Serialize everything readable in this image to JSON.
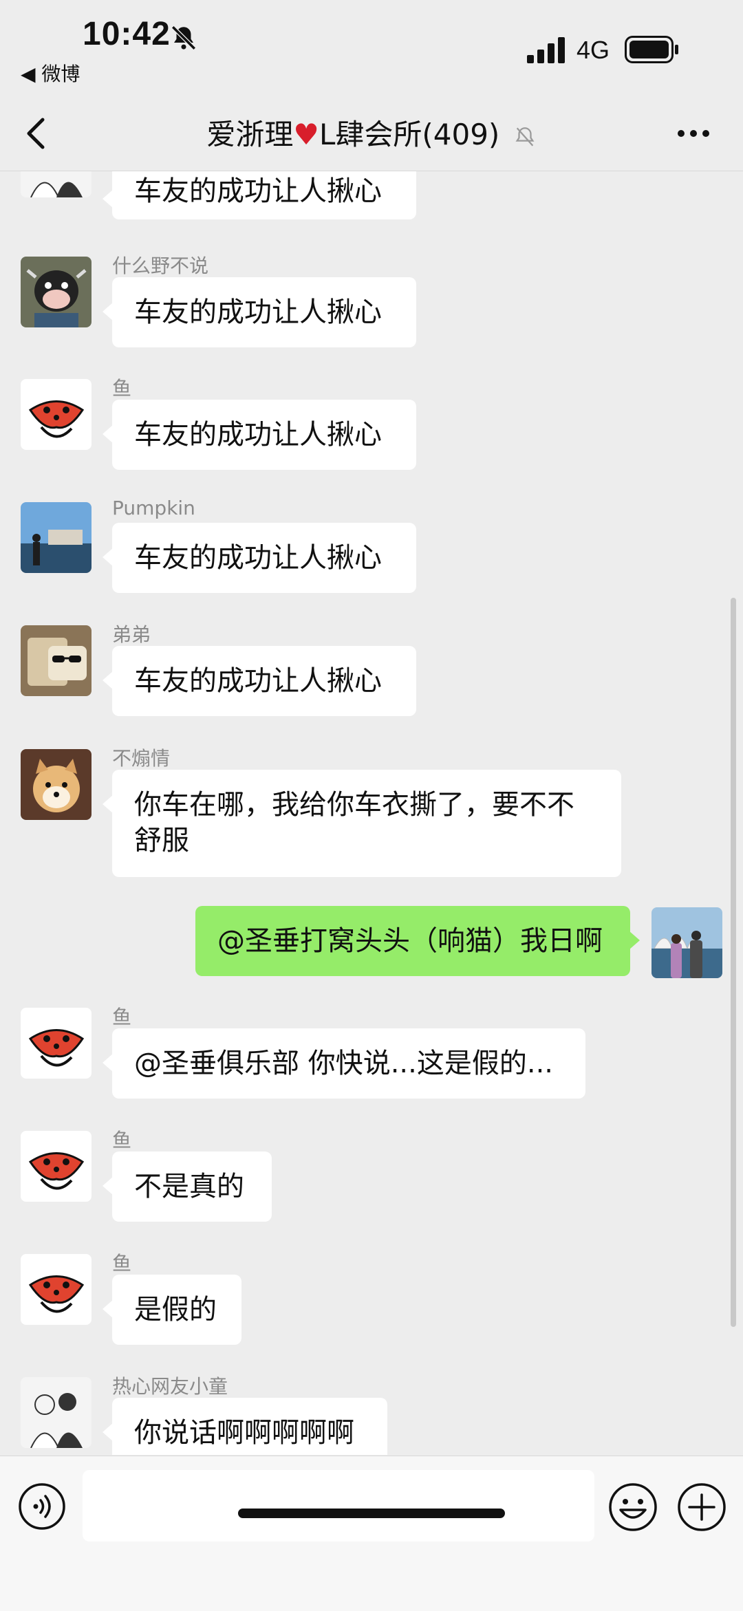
{
  "status_bar": {
    "time": "10:42",
    "back_app": "◀ 微博",
    "network": "4G"
  },
  "nav": {
    "title_prefix": "爱浙理",
    "title_suffix": "L肆会所(409)"
  },
  "messages": [
    {
      "sender": "",
      "text": "车友的成功让人揪心",
      "avatar_icon": "couple-sketch-avatar"
    },
    {
      "sender": "什么野不说",
      "text": "车友的成功让人揪心",
      "avatar_icon": "cow-avatar"
    },
    {
      "sender": "鱼",
      "text": "车友的成功让人揪心",
      "avatar_icon": "red-mask-avatar"
    },
    {
      "sender": "Pumpkin",
      "text": "车友的成功让人揪心",
      "avatar_icon": "harbor-photo-avatar"
    },
    {
      "sender": "弟弟",
      "text": "车友的成功让人揪心",
      "avatar_icon": "sunglasses-cat-avatar"
    },
    {
      "sender": "不煽情",
      "text": "你车在哪，我给你车衣撕了，要不不舒服",
      "avatar_icon": "shiba-avatar"
    },
    {
      "sender": "",
      "text": "@圣垂打窝头头（响猫）我日啊",
      "avatar_icon": "opera-house-avatar",
      "mine": true
    },
    {
      "sender": "鱼",
      "text": "@圣垂俱乐部 你快说...这是假的...",
      "avatar_icon": "red-mask-avatar"
    },
    {
      "sender": "鱼",
      "text": "不是真的",
      "avatar_icon": "red-mask-avatar"
    },
    {
      "sender": "鱼",
      "text": "是假的",
      "avatar_icon": "red-mask-avatar"
    },
    {
      "sender": "热心网友小童",
      "text": "你说话啊啊啊啊啊",
      "avatar_icon": "couple-sketch-avatar"
    }
  ],
  "input": {
    "placeholder": ""
  },
  "colors": {
    "background": "#ededed",
    "my_bubble": "#95ec69",
    "other_bubble": "#ffffff",
    "heart": "#d81e2b"
  }
}
